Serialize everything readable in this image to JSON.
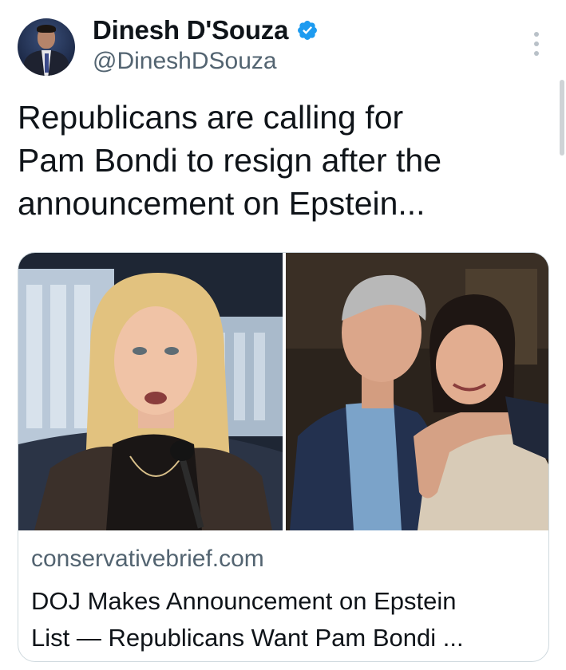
{
  "author": {
    "display_name": "Dinesh D'Souza",
    "handle": "@DineshDSouza",
    "verified": true,
    "verified_color": "#1d9bf0"
  },
  "tweet": {
    "text": "Republicans are calling for\nPam Bondi to resign after the\nannouncement on Epstein..."
  },
  "link_card": {
    "domain": "conservativebrief.com",
    "title": "DOJ Makes Announcement on Epstein\nList — Republicans Want Pam Bondi ..."
  },
  "icons": {
    "more": "more-options-icon",
    "verified": "verified-badge-icon"
  }
}
